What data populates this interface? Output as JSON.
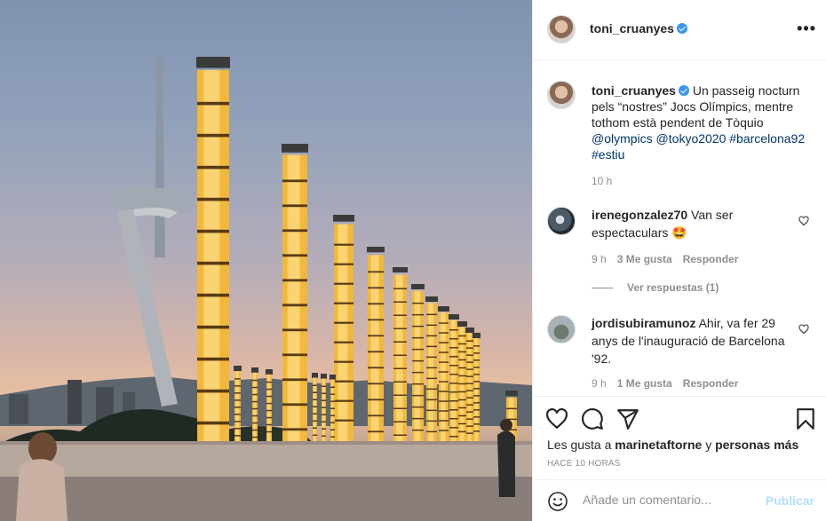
{
  "post": {
    "photo_icon": "olympic-ring-columns-photo"
  },
  "header": {
    "username": "toni_cruanyes",
    "verified_icon": "verified-badge-icon",
    "more_icon": "more-options-icon",
    "more_label": "•••"
  },
  "caption": {
    "username": "toni_cruanyes",
    "text": "Un passeig nocturn pels “nostres” Jocs Olímpics, mentre tothom està pendent de Tòquio",
    "tags": "@olympics @tokyo2020 #barcelona92 #estiu",
    "time": "10 h"
  },
  "comments": [
    {
      "username": "irenegonzalez70",
      "text": "Van ser espectaculars 🤩",
      "time": "9 h",
      "likes": "3 Me gusta",
      "reply": "Responder",
      "view_replies": "Ver respuestas (1)"
    },
    {
      "username": "jordisubiramunoz",
      "text": "Ahir, va fer 29 anys de l'inauguració de Barcelona '92.",
      "time": "9 h",
      "likes": "1 Me gusta",
      "reply": "Responder"
    }
  ],
  "actions": {
    "like_icon": "heart-icon",
    "comment_icon": "comment-icon",
    "share_icon": "paper-plane-icon",
    "save_icon": "bookmark-icon",
    "likes_prefix": "Les gusta a",
    "liker": "marinetaftorne",
    "likes_conj": "y",
    "likes_rest": "personas más",
    "posted_time": "HACE 10 HORAS"
  },
  "add_comment": {
    "emoji_icon": "smiley-icon",
    "placeholder": "Añade un comentario...",
    "post_label": "Publicar"
  },
  "colors": {
    "link": "#00376b",
    "verified": "#3897f0",
    "post_button": "#b2dffc",
    "muted": "#8e8e8e"
  }
}
